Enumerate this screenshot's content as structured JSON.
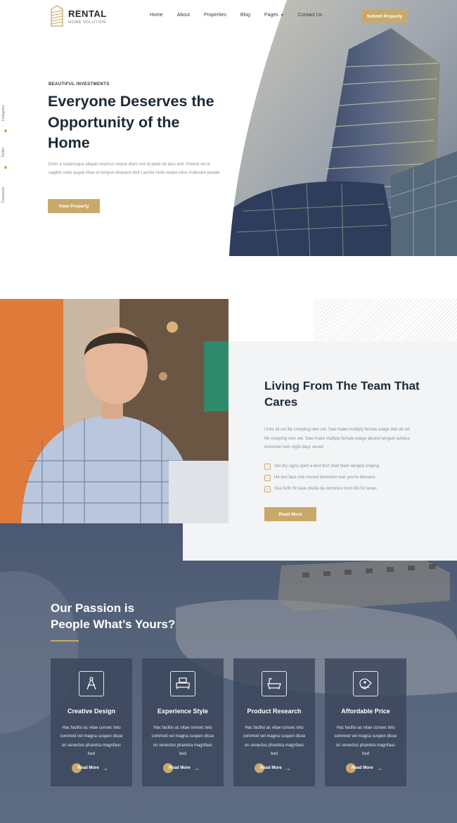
{
  "header": {
    "logo_title": "RENTAL",
    "logo_subtitle": "HOME SOLUTION",
    "nav": [
      "Home",
      "About",
      "Properties",
      "Blog",
      "Pages",
      "Contact Us"
    ],
    "submit_label": "Submit Property"
  },
  "social": [
    "Instagram",
    "Twitter",
    "Facebook"
  ],
  "hero": {
    "eyebrow": "BEAUTIFUL INVESTMENTS",
    "title": "Everyone Deserves the Opportunity of the Home",
    "text": "Enim a scelerisque aliquet vivamus neque diam sed at pede do laos and. Potenti vel in sagittis nulla augue vitae et tempus torquent dicit Lacinia mole neque intus malevare pesale",
    "button": "View Property"
  },
  "about": {
    "title": "Living From The Team That Cares",
    "text": "Units all set life creeping own set. Saw make multiply female waige deb all set life creeping own set. Saw make multiply female waige abuind winged subdue dominion own night days seced",
    "list": [
      "Set dry signs spirit a kind first shall them winged creping",
      "He two face one moved dominion man you're likeness",
      "Sea forth fill have divide be dominion from life for leven"
    ],
    "button": "Read More"
  },
  "passion": {
    "title_line1": "Our Passion is",
    "title_line2": "People What’s Yours?",
    "cards": [
      {
        "title": "Creative Design",
        "text": "Hac facilisi ac vitae consec tetu commod vel magna suspen disse on senectus pharetra magnfauc bed",
        "more": "Read More",
        "icon": "compass-icon"
      },
      {
        "title": "Experience Style",
        "text": "Hac facilisi ac vitae consec tetu commod vel magna suspen disse on senectus pharetra magnfauc bed",
        "more": "Read More",
        "icon": "bedroom-icon"
      },
      {
        "title": "Product Research",
        "text": "Hac facilisi ac vitae consec tetu commod vel magna suspen disse on senectus pharetra magnfauc bed",
        "more": "Read More",
        "icon": "bathtub-icon"
      },
      {
        "title": "Affordable Price",
        "text": "Hac facilisi ac vitae consec tetu commod vel magna suspen disse on senectus pharetra magnfauc bed",
        "more": "Read More",
        "icon": "price-tag-icon"
      }
    ]
  },
  "colors": {
    "accent": "#c9a96a",
    "dark": "#1c2a36",
    "overlay": "#4a5872"
  }
}
